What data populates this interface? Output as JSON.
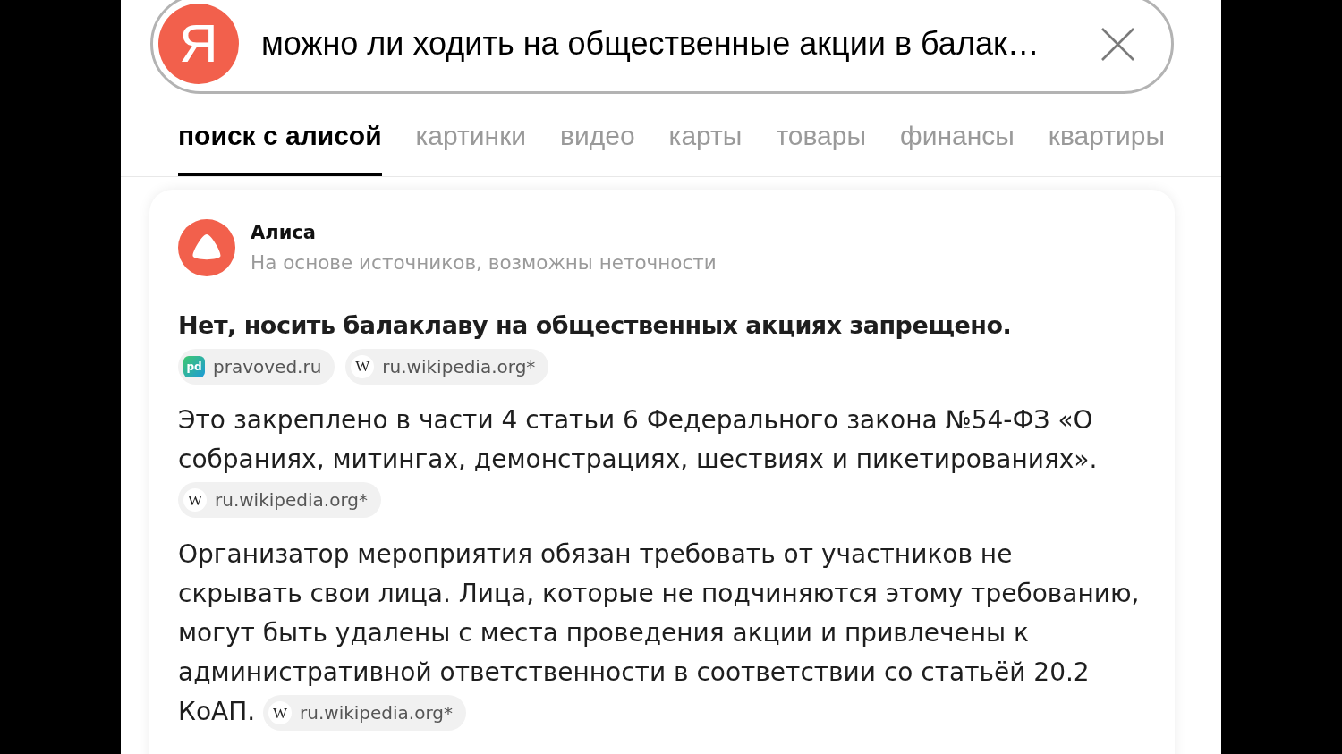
{
  "search": {
    "logo_letter": "Я",
    "value": "можно ли ходить на общественные акции в балак…"
  },
  "tabs": [
    {
      "label": "поиск с алисой",
      "selected": true
    },
    {
      "label": "картинки",
      "selected": false
    },
    {
      "label": "видео",
      "selected": false
    },
    {
      "label": "карты",
      "selected": false
    },
    {
      "label": "товары",
      "selected": false
    },
    {
      "label": "финансы",
      "selected": false
    },
    {
      "label": "квартиры",
      "selected": false
    }
  ],
  "answer": {
    "author": "Алиса",
    "note": "На основе источников, возможны неточности",
    "blocks": [
      {
        "kind": "heading",
        "text": "Нет, носить балаклаву на общественных акциях запрещено.",
        "sources": [
          {
            "kind": "tile",
            "glyph": "pd",
            "label": "pravoved.ru"
          },
          {
            "kind": "disc",
            "glyph": "W",
            "label": "ru.wikipedia.org*"
          }
        ]
      },
      {
        "kind": "paragraph",
        "text": "Это закреплено в части 4 статьи 6 Федерального закона №54-ФЗ «О собраниях, митингах, демонстрациях, шествиях и пикетированиях».",
        "sources": [
          {
            "kind": "disc",
            "glyph": "W",
            "label": "ru.wikipedia.org*"
          }
        ]
      },
      {
        "kind": "paragraph",
        "text": "Организатор мероприятия обязан требовать от участников не скрывать свои лица. Лица, которые не подчиняются этому требованию, могут быть удалены с места проведения акции и привлечены к административной ответственности в соответствии со статьёй 20.2 КоАП.",
        "sources": [
          {
            "kind": "disc",
            "glyph": "W",
            "label": "ru.wikipedia.org*"
          }
        ]
      }
    ]
  }
}
